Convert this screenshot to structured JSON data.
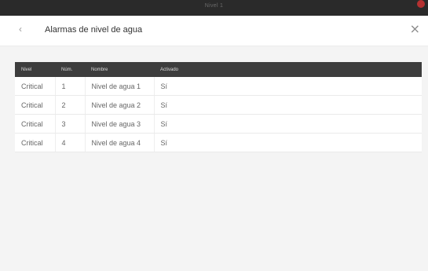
{
  "window": {
    "title": "Nivel 1"
  },
  "header": {
    "back_icon": "‹",
    "title": "Alarmas de nivel de agua",
    "close_icon": "×"
  },
  "table": {
    "columns": [
      "Nivel",
      "Núm.",
      "Nombre",
      "Activado"
    ],
    "rows": [
      [
        "Critical",
        "1",
        "Nivel de agua 1",
        "Sí"
      ],
      [
        "Critical",
        "2",
        "Nivel de agua 2",
        "Sí"
      ],
      [
        "Critical",
        "3",
        "Nivel de agua 3",
        "Sí"
      ],
      [
        "Critical",
        "4",
        "Nivel de agua 4",
        "Sí"
      ]
    ]
  }
}
